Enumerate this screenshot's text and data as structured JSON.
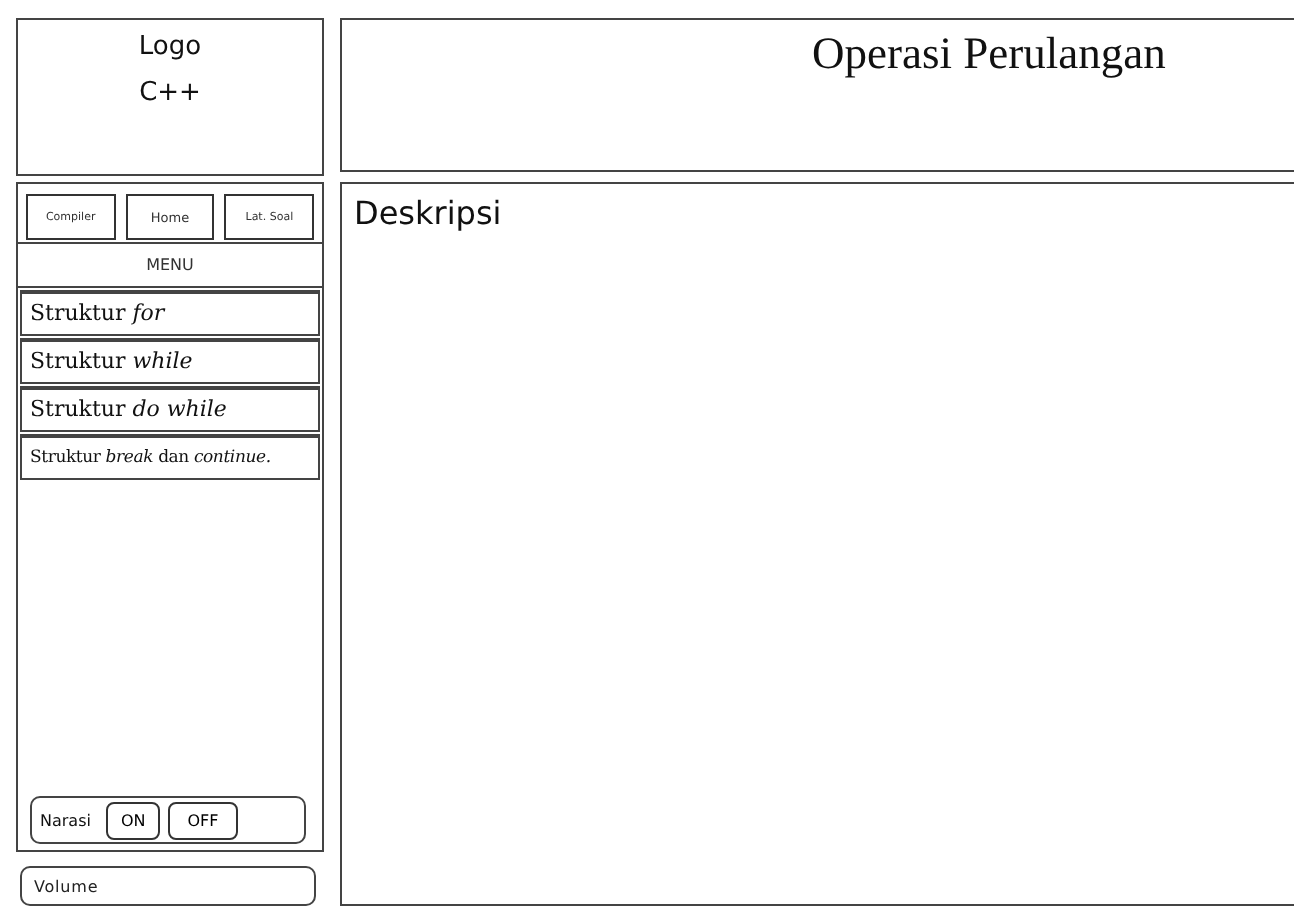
{
  "logo": {
    "label": "Logo",
    "subtitle": "C++"
  },
  "header": {
    "title": "Operasi Perulangan"
  },
  "nav_buttons": [
    "Compiler",
    "Home",
    "Lat. Soal"
  ],
  "menu": {
    "title": "MENU",
    "items": [
      {
        "label": "Struktur *for*"
      },
      {
        "label": "Struktur *while*"
      },
      {
        "label": "Struktur *do while*"
      },
      {
        "label": "Struktur *break* dan *continue.*",
        "kind": "small"
      }
    ]
  },
  "narration": {
    "label": "Narasi",
    "buttons": [
      "ON",
      "OFF"
    ]
  },
  "volume": {
    "placeholder": "Volume"
  },
  "content": {
    "heading": "Deskripsi"
  }
}
